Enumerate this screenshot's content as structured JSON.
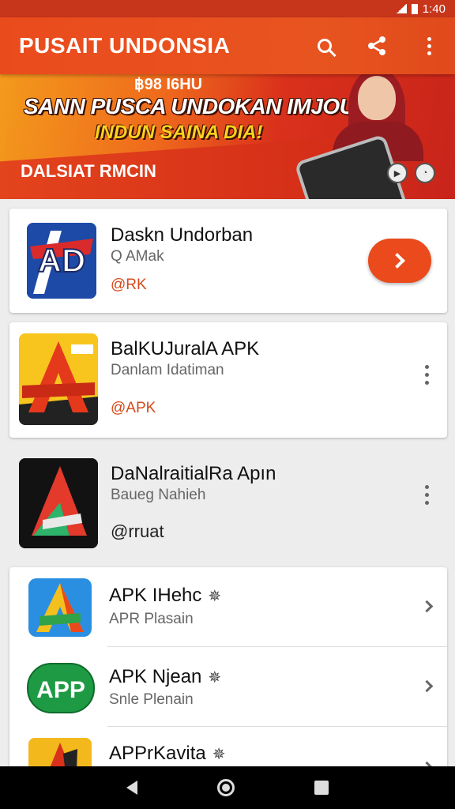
{
  "status_bar": {
    "time": "1:40"
  },
  "app_bar": {
    "title": "PUSAIT UNDONSIA"
  },
  "banner": {
    "top_text": "฿98 I6HU",
    "headline": "SANN PUSCA UNDOKAN IMJOUAN",
    "subheadline": "INDUN SAINA DIA!",
    "cta": "DALSIAT RMCIN"
  },
  "featured": [
    {
      "title": "Daskn Undorban",
      "subtitle": "Q AMak",
      "tag": "@RK",
      "icon_text": "AD"
    },
    {
      "title": "BalKUJuralA APK",
      "subtitle": "Danlam Idatiman",
      "tag": "@APK"
    },
    {
      "title": "DaNalraitialRa Apın",
      "subtitle": "Baueg Nahieh",
      "tag": "@rruat"
    }
  ],
  "list": [
    {
      "title": "APK IHehc",
      "subtitle": "APR Plasain"
    },
    {
      "title": "APK Njean",
      "subtitle": "Snle Plenain",
      "icon_text": "APP"
    },
    {
      "title": "APPrKavita",
      "subtitle": ""
    }
  ],
  "colors": {
    "primary": "#ea4b1d",
    "status_bar": "#c7351b",
    "tag": "#d44a1a"
  }
}
